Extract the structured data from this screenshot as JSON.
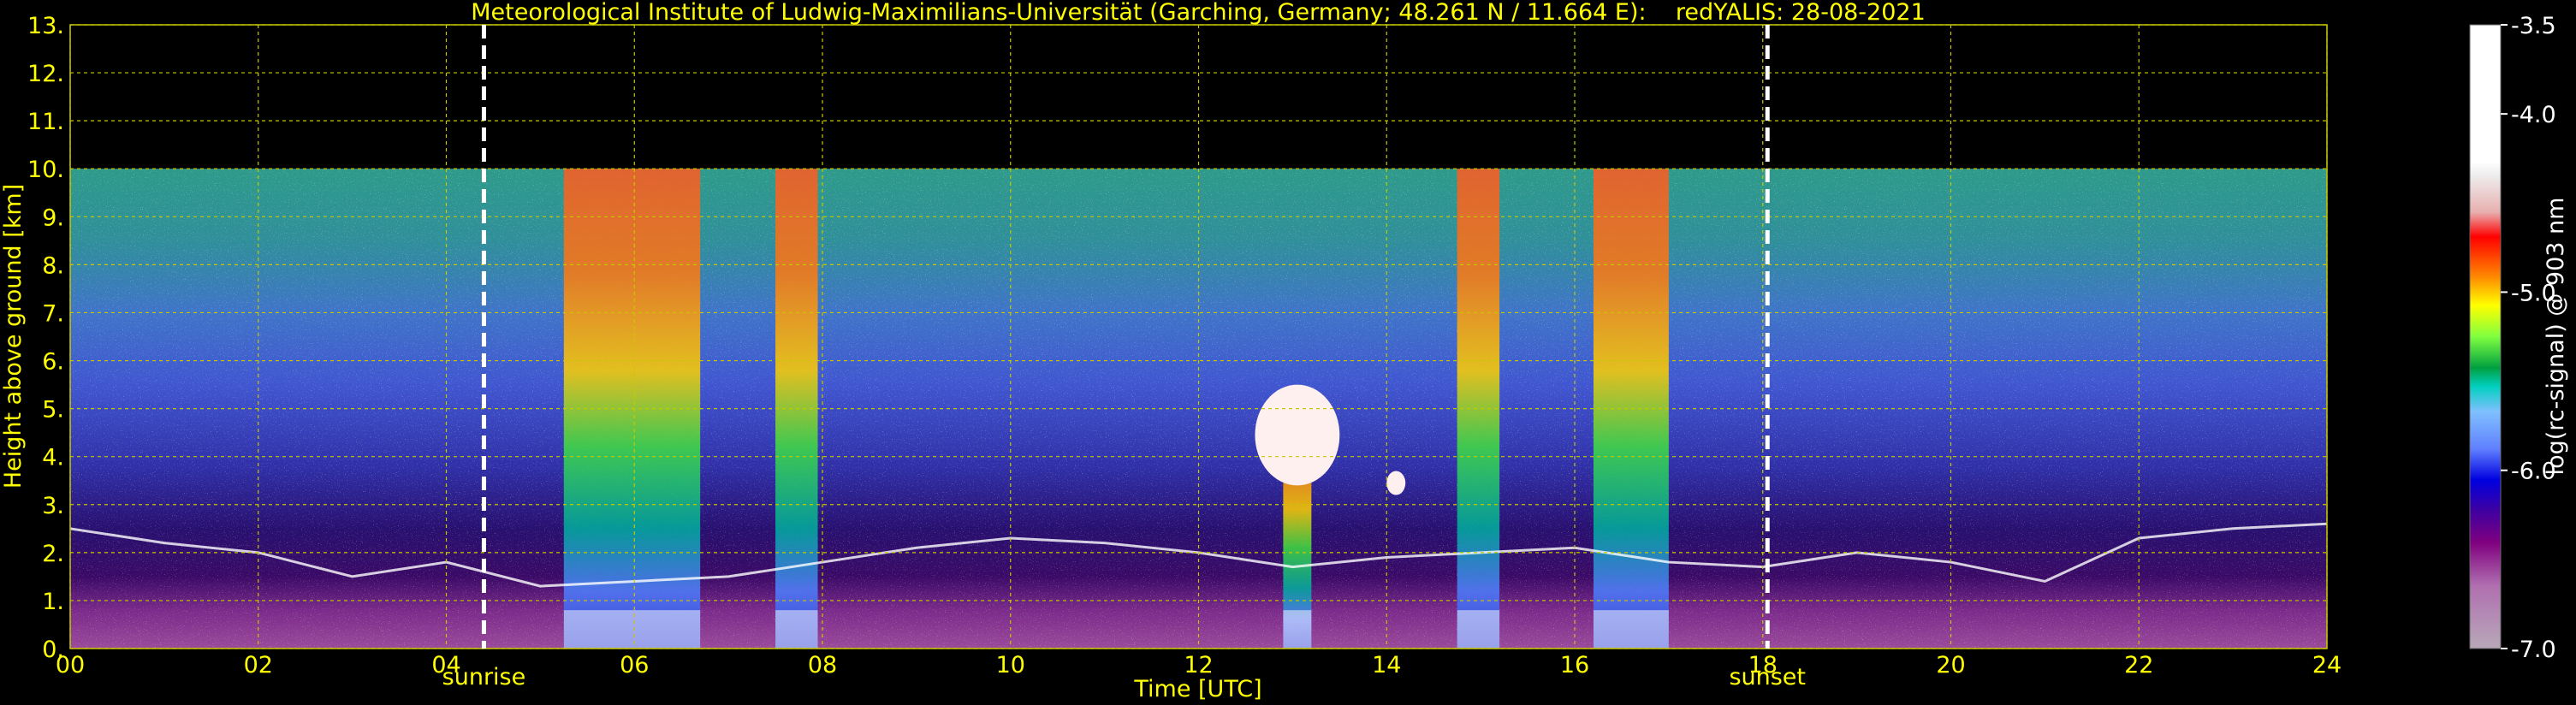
{
  "chart_data": {
    "type": "heatmap",
    "title": "Meteorological Institute of Ludwig-Maximilians-Universität (Garching, Germany; 48.261 N / 11.664 E):    redYALIS: 28-08-2021",
    "xlabel": "Time [UTC]",
    "ylabel": "Height above ground [km]",
    "xlim": [
      0,
      24
    ],
    "ylim": [
      0,
      13
    ],
    "x_ticks": [
      0,
      2,
      4,
      6,
      8,
      10,
      12,
      14,
      16,
      18,
      20,
      22,
      24
    ],
    "x_tick_labels": [
      "00",
      "02",
      "04",
      "06",
      "08",
      "10",
      "12",
      "14",
      "16",
      "18",
      "20",
      "22",
      "24"
    ],
    "y_ticks": [
      0,
      1,
      2,
      3,
      4,
      5,
      6,
      7,
      8,
      9,
      10,
      11,
      12,
      13
    ],
    "y_tick_labels": [
      "0.",
      "1.",
      "2.",
      "3.",
      "4.",
      "5.",
      "6.",
      "7.",
      "8.",
      "9.",
      "10.",
      "11.",
      "12.",
      "13."
    ],
    "grid": true,
    "data_top_km": 10,
    "events": [
      {
        "label": "sunrise",
        "x": 4.4
      },
      {
        "label": "sunset",
        "x": 18.05
      }
    ],
    "colorbar": {
      "label": "log(rc-signal) @ 903 nm",
      "range": [
        -7.0,
        -3.5
      ],
      "ticks": [
        -3.5,
        -4.0,
        -5.0,
        -6.0,
        -7.0
      ],
      "tick_labels": [
        "-3.5",
        "-4.0",
        "-5.0",
        "-6.0",
        "-7.0"
      ],
      "colors": [
        "#ffffff",
        "#eeeeee",
        "#e8b0b0",
        "#ff0000",
        "#ff8000",
        "#ffc000",
        "#ffff00",
        "#c0ff40",
        "#00e000",
        "#00a040",
        "#00d0c0",
        "#80c0ff",
        "#6080ff",
        "#2040ff",
        "#0000c0",
        "#4000a0",
        "#800080",
        "#a040a0",
        "#c090c0",
        "#b0a0b0"
      ]
    },
    "rain_shafts": [
      {
        "x0": 5.25,
        "x1": 6.7,
        "top": 10.0
      },
      {
        "x0": 7.5,
        "x1": 7.95,
        "top": 10.0
      },
      {
        "x0": 12.9,
        "x1": 13.2,
        "top": 5.0
      },
      {
        "x0": 14.75,
        "x1": 15.2,
        "top": 10.0
      },
      {
        "x0": 16.2,
        "x1": 17.0,
        "top": 10.0
      }
    ],
    "clouds": [
      {
        "x0": 12.6,
        "x1": 13.5,
        "y0": 3.4,
        "y1": 5.5
      },
      {
        "x0": 14.0,
        "x1": 14.2,
        "y0": 3.2,
        "y1": 3.7
      }
    ],
    "cloud_base_km": [
      {
        "x": 0.0,
        "y": 2.5
      },
      {
        "x": 1.0,
        "y": 2.2
      },
      {
        "x": 2.0,
        "y": 2.0
      },
      {
        "x": 3.0,
        "y": 1.5
      },
      {
        "x": 4.0,
        "y": 1.8
      },
      {
        "x": 5.0,
        "y": 1.3
      },
      {
        "x": 6.0,
        "y": 1.4
      },
      {
        "x": 7.0,
        "y": 1.5
      },
      {
        "x": 8.0,
        "y": 1.8
      },
      {
        "x": 9.0,
        "y": 2.1
      },
      {
        "x": 10.0,
        "y": 2.3
      },
      {
        "x": 11.0,
        "y": 2.2
      },
      {
        "x": 12.0,
        "y": 2.0
      },
      {
        "x": 13.0,
        "y": 1.7
      },
      {
        "x": 14.0,
        "y": 1.9
      },
      {
        "x": 15.0,
        "y": 2.0
      },
      {
        "x": 16.0,
        "y": 2.1
      },
      {
        "x": 17.0,
        "y": 1.8
      },
      {
        "x": 18.0,
        "y": 1.7
      },
      {
        "x": 19.0,
        "y": 2.0
      },
      {
        "x": 20.0,
        "y": 1.8
      },
      {
        "x": 21.0,
        "y": 1.4
      },
      {
        "x": 22.0,
        "y": 2.3
      },
      {
        "x": 23.0,
        "y": 2.5
      },
      {
        "x": 24.0,
        "y": 2.6
      }
    ]
  }
}
